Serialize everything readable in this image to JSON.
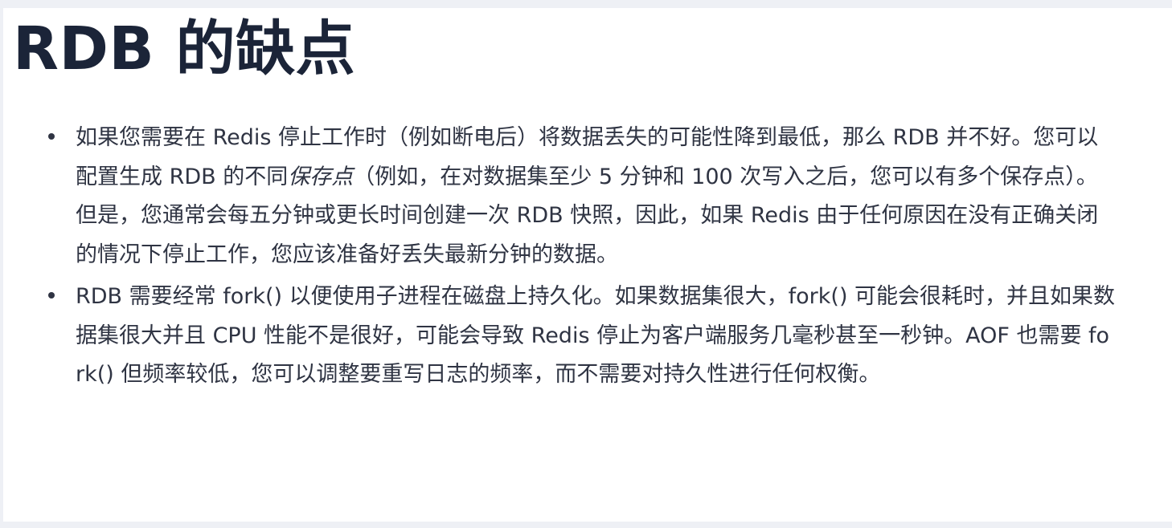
{
  "article": {
    "title": "RDB 的缺点",
    "bullets": [
      {
        "text_before": "如果您需要在 Redis 停止工作时（例如断电后）将数据丢失的可能性降到最低，那么 RDB 并不好。您可以配置生成 RDB 的不同",
        "emphasis": "保存点",
        "text_after": "（例如，在对数据集至少 5 分钟和 100 次写入之后，您可以有多个保存点）。但是，您通常会每五分钟或更长时间创建一次 RDB 快照，因此，如果 Redis 由于任何原因在没有正确关闭的情况下停止工作，您应该准备好丢失最新分钟的数据。"
      },
      {
        "text": "RDB 需要经常 fork() 以便使用子进程在磁盘上持久化。如果数据集很大，fork() 可能会很耗时，并且如果数据集很大并且 CPU 性能不是很好，可能会导致 Redis 停止为客户端服务几毫秒甚至一秒钟。AOF 也需要 fork() 但频率较低，您可以调整要重写日志的频率，而不需要对持久性进行任何权衡。"
      }
    ]
  }
}
